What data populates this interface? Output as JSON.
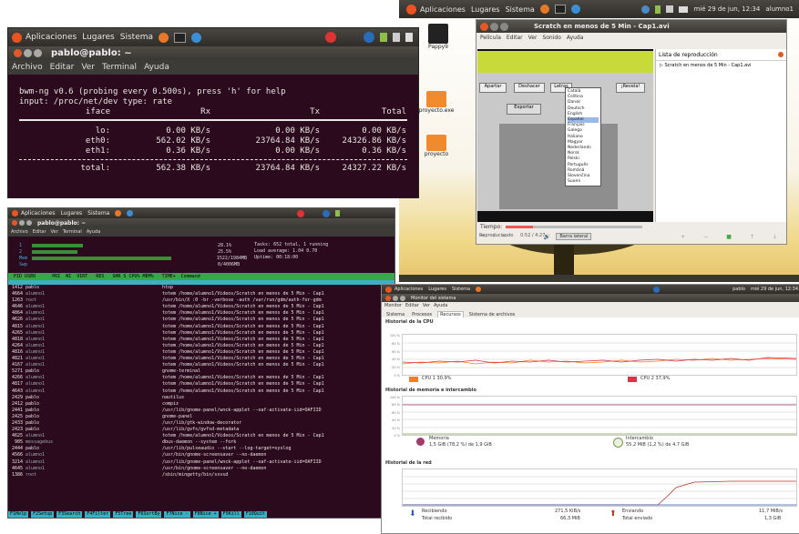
{
  "win1": {
    "panel": {
      "apps": "Aplicaciones",
      "places": "Lugares",
      "system": "Sistema"
    },
    "title": "pablo@pablo: ~",
    "menu": [
      "Archivo",
      "Editar",
      "Ver",
      "Terminal",
      "Ayuda"
    ],
    "header": "bwm-ng v0.6 (probing every 0.500s), press 'h' for help",
    "input": "input: /proc/net/dev type: rate",
    "cols": [
      "iface",
      "Rx",
      "Tx",
      "Total"
    ],
    "rows": [
      {
        "iface": "lo:",
        "rx": "0.00 KB/s",
        "tx": "0.00 KB/s",
        "total": "0.00 KB/s"
      },
      {
        "iface": "eth0:",
        "rx": "562.02 KB/s",
        "tx": "23764.84 KB/s",
        "total": "24326.86 KB/s"
      },
      {
        "iface": "eth1:",
        "rx": "0.36 KB/s",
        "tx": "0.00 KB/s",
        "total": "0.36 KB/s"
      }
    ],
    "total": {
      "label": "total:",
      "rx": "562.38 KB/s",
      "tx": "23764.84 KB/s",
      "total": "24327.22 KB/s"
    }
  },
  "desktop": {
    "panel": {
      "apps": "Aplicaciones",
      "places": "Lugares",
      "system": "Sistema",
      "clock": "mié 29 de jun, 12:34",
      "user": "alumno1"
    },
    "icons": [
      "Pappy9",
      "proyecto.exe",
      "proyecto"
    ]
  },
  "video": {
    "title": "Scratch en menos de 5 Min - Cap1.avi",
    "menu": [
      "Película",
      "Editar",
      "Ver",
      "Sonido",
      "Ayuda"
    ],
    "playlist_label": "Lista de reproducción",
    "playlist_item": "Scratch en menos de 5 Min - Cap1.avi",
    "buttons": [
      "Apartar",
      "Deshacer",
      "Letras",
      "¡Revela!",
      "Exportar"
    ],
    "languages": [
      "Català",
      "Čeština",
      "Dansk",
      "Deutsch",
      "English",
      "Español",
      "Français",
      "Galego",
      "Italiano",
      "Magyar",
      "Nederlands",
      "Norsk",
      "Polski",
      "Português",
      "Română",
      "Slovenčina",
      "Suomi"
    ],
    "time_label": "Tiempo:",
    "status": "Reproduciendo",
    "time": "0:52 / 4:27",
    "fullscreen": "Barra lateral"
  },
  "win3": {
    "title": "pablo@pablo: ~",
    "menu": [
      "Archivo",
      "Editar",
      "Ver",
      "Terminal",
      "Ayuda"
    ],
    "bars": [
      {
        "label": "1",
        "value": "28.1%"
      },
      {
        "label": "2",
        "value": "25.5%"
      },
      {
        "label": "Mem",
        "value": "1522/1984MB"
      },
      {
        "label": "Swp",
        "value": "0/4006MB"
      }
    ],
    "tasks": "Tasks: 652 total, 1 running",
    "load": "Load average: 1.04 0.70",
    "uptime": "Uptime: 00:18:00",
    "header": "  PID USER      PRI  NI  VIRT   RES   SHR S CPU% MEM%   TIME+  Command",
    "proc": [
      {
        "pid": "1412",
        "user": "pablo",
        "cmd": "htop"
      },
      {
        "pid": "4664",
        "user": "alumno1",
        "cmd": "totem /home/alumno1/Vídeos/Scratch en menos de 5 Min - Cap1"
      },
      {
        "pid": "1263",
        "user": "root",
        "cmd": "/usr/bin/X :0 -br -verbose -auth /var/run/gdm/auth-for-gdm"
      },
      {
        "pid": "4646",
        "user": "alumno1",
        "cmd": "totem /home/alumno1/Vídeos/Scratch en menos de 5 Min - Cap1"
      },
      {
        "pid": "4864",
        "user": "alumno1",
        "cmd": "totem /home/alumno1/Vídeos/Scratch en menos de 5 Min - Cap1"
      },
      {
        "pid": "4626",
        "user": "alumno1",
        "cmd": "totem /home/alumno1/Vídeos/Scratch en menos de 5 Min - Cap1"
      },
      {
        "pid": "4815",
        "user": "alumno1",
        "cmd": "totem /home/alumno1/Vídeos/Scratch en menos de 5 Min - Cap1"
      },
      {
        "pid": "4265",
        "user": "alumno1",
        "cmd": "totem /home/alumno1/Vídeos/Scratch en menos de 5 Min - Cap1"
      },
      {
        "pid": "4818",
        "user": "alumno1",
        "cmd": "totem /home/alumno1/Vídeos/Scratch en menos de 5 Min - Cap1"
      },
      {
        "pid": "4264",
        "user": "alumno1",
        "cmd": "totem /home/alumno1/Vídeos/Scratch en menos de 5 Min - Cap1"
      },
      {
        "pid": "4816",
        "user": "alumno1",
        "cmd": "totem /home/alumno1/Vídeos/Scratch en menos de 5 Min - Cap1"
      },
      {
        "pid": "4821",
        "user": "alumno1",
        "cmd": "totem /home/alumno1/Vídeos/Scratch en menos de 5 Min - Cap1"
      },
      {
        "pid": "4167",
        "user": "alumno1",
        "cmd": "totem /home/alumno1/Vídeos/Scratch en menos de 5 Min - Cap1"
      },
      {
        "pid": "5271",
        "user": "pablo",
        "cmd": "gnome-terminal"
      },
      {
        "pid": "4266",
        "user": "alumno1",
        "cmd": "totem /home/alumno1/Vídeos/Scratch en menos de 5 Min - Cap1"
      },
      {
        "pid": "4817",
        "user": "alumno1",
        "cmd": "totem /home/alumno1/Vídeos/Scratch en menos de 5 Min - Cap1"
      },
      {
        "pid": "4643",
        "user": "alumno1",
        "cmd": "totem /home/alumno1/Vídeos/Scratch en menos de 5 Min - Cap1"
      },
      {
        "pid": "2429",
        "user": "pablo",
        "cmd": "nautilus"
      },
      {
        "pid": "2412",
        "user": "pablo",
        "cmd": "compiz"
      },
      {
        "pid": "2441",
        "user": "pablo",
        "cmd": "/usr/lib/gnome-panel/wnck-applet --oaf-activate-iid=OAFIID"
      },
      {
        "pid": "2425",
        "user": "pablo",
        "cmd": "gnome-panel"
      },
      {
        "pid": "2433",
        "user": "pablo",
        "cmd": "/usr/lib/gtk-window-decorator"
      },
      {
        "pid": "2423",
        "user": "pablo",
        "cmd": "/usr/lib/gvfs/gvfsd-metadata"
      },
      {
        "pid": "4625",
        "user": "alumno1",
        "cmd": "totem /home/alumno1/Vídeos/Scratch en menos de 5 Min - Cap1"
      },
      {
        "pid": "905",
        "user": "messagebus",
        "cmd": "dbus-daemon --system --fork"
      },
      {
        "pid": "2444",
        "user": "pablo",
        "cmd": "/usr/lib/pulseaudio --start --log-target=syslog"
      },
      {
        "pid": "4566",
        "user": "alumno1",
        "cmd": "/usr/bin/gnome-screensaver --no-daemon"
      },
      {
        "pid": "3214",
        "user": "alumno1",
        "cmd": "/usr/lib/gnome-panel/wnck-applet --oaf-activate-iid=OAFIID"
      },
      {
        "pid": "4645",
        "user": "alumno1",
        "cmd": "/usr/bin/gnome-screensaver --no-daemon"
      },
      {
        "pid": "1386",
        "user": "root",
        "cmd": "/sbin/mingetty/bin/ssvsd"
      }
    ],
    "fkeys": [
      "F1Help",
      "F2Setup",
      "F3Search",
      "F4Filter",
      "F5Tree",
      "F6SortBy",
      "F7Nice -",
      "F8Nice +",
      "F9Kill",
      "F10Quit"
    ]
  },
  "monitor": {
    "panel": {
      "apps": "Aplicaciones",
      "places": "Lugares",
      "system": "Sistema",
      "user": "pablo",
      "clock": "mié 29 de jun, 12:34"
    },
    "title": "Monitor del sistema",
    "menu": [
      "Monitor",
      "Editar",
      "Ver",
      "Ayuda"
    ],
    "tabs": [
      "Sistema",
      "Procesos",
      "Recursos",
      "Sistema de archivos"
    ],
    "active_tab": "Recursos",
    "cpu_title": "Historial de la CPU",
    "cpu1": "CPU 1 30,9%",
    "cpu2": "CPU 2 37,9%",
    "mem_title": "Historial de memoria e intercambio",
    "mem_label": "Memoria",
    "mem_value": "1,5 GiB (78,2 %) de 1,9 GiB",
    "swap_label": "Intercambio",
    "swap_value": "55,2 MiB (1,2 %) de 4,7 GiB",
    "net_title": "Historial de la red",
    "recv_label": "Recibiendo",
    "recv_total_label": "Total recibido",
    "recv_rate": "271,5 KiB/s",
    "recv_total": "66,3 MiB",
    "send_label": "Enviando",
    "send_total_label": "Total enviado",
    "send_rate": "11,7 MiB/s",
    "send_total": "1,3 GiB",
    "ylabels": [
      "100 %",
      "80 %",
      "60 %",
      "40 %",
      "20 %",
      "0 %"
    ],
    "colors": {
      "cpu1": "#f27d2b",
      "cpu2": "#e0304a",
      "mem": "#a3386b",
      "swap": "#7a9a49",
      "recv": "#2a5aa8",
      "send": "#b03a2e"
    }
  }
}
